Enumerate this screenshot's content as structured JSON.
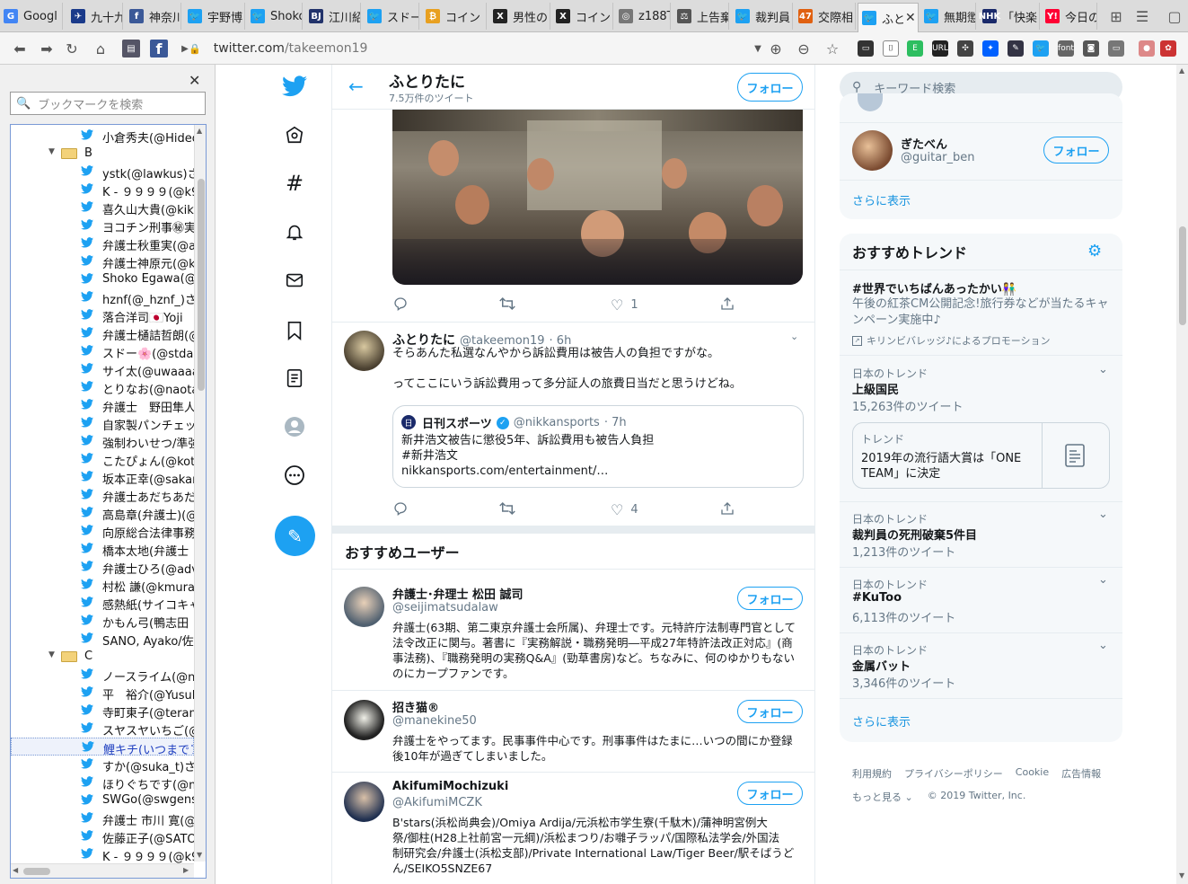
{
  "browser": {
    "tabs": [
      {
        "label": "Googl",
        "icon": "google-icon",
        "color": "#4285f4",
        "glyph": "G"
      },
      {
        "label": "九十九",
        "icon": "ship-icon",
        "color": "#1a3a8a",
        "glyph": "✈"
      },
      {
        "label": "神奈川",
        "icon": "facebook-icon",
        "color": "#3b5998",
        "glyph": "f"
      },
      {
        "label": "宇野博",
        "icon": "twitter-icon",
        "color": "#1da1f2",
        "glyph": "🐦"
      },
      {
        "label": "Shoko",
        "icon": "twitter-icon",
        "color": "#1da1f2",
        "glyph": "🐦"
      },
      {
        "label": "江川紹",
        "icon": "bj-icon",
        "color": "#22336b",
        "glyph": "BJ"
      },
      {
        "label": "スドー",
        "icon": "twitter-icon",
        "color": "#1da1f2",
        "glyph": "🐦"
      },
      {
        "label": "コイン",
        "icon": "coin-icon",
        "color": "#e8a020",
        "glyph": "₿"
      },
      {
        "label": "男性の",
        "icon": "x-icon",
        "color": "#222222",
        "glyph": "X"
      },
      {
        "label": "コイン",
        "icon": "x-icon",
        "color": "#222222",
        "glyph": "X"
      },
      {
        "label": "z188T",
        "icon": "globe-icon",
        "color": "#777777",
        "glyph": "◎"
      },
      {
        "label": "上告棄",
        "icon": "scale-icon",
        "color": "#555555",
        "glyph": "⚖"
      },
      {
        "label": "裁判員",
        "icon": "twitter-icon",
        "color": "#1da1f2",
        "glyph": "🐦"
      },
      {
        "label": "交際相",
        "icon": "news47-icon",
        "color": "#e06010",
        "glyph": "47"
      },
      {
        "label": "ふと",
        "icon": "twitter-icon",
        "color": "#1da1f2",
        "glyph": "🐦",
        "active": true
      },
      {
        "label": "無期懲",
        "icon": "twitter-icon",
        "color": "#1da1f2",
        "glyph": "🐦"
      },
      {
        "label": "「快楽",
        "icon": "nhk-icon",
        "color": "#1a2a6a",
        "glyph": "NHK"
      },
      {
        "label": "今日の",
        "icon": "yahoo-icon",
        "color": "#ff0033",
        "glyph": "Y!"
      }
    ],
    "url_host": "twitter.com",
    "url_path": "/takeemon19"
  },
  "bookmarks": {
    "search_placeholder": "ブックマークを検索",
    "items": [
      {
        "type": "link",
        "label": "小倉秀夫(@Hideo"
      },
      {
        "type": "folder",
        "label": "B"
      },
      {
        "type": "link",
        "label": "ystk(@lawkus)さん"
      },
      {
        "type": "link",
        "label": "K - ９９９９(@k99"
      },
      {
        "type": "link",
        "label": "喜久山大貴(@kik"
      },
      {
        "type": "link",
        "label": "ヨコチン刑事㊙実"
      },
      {
        "type": "link",
        "label": "弁護士秋重実(@a"
      },
      {
        "type": "link",
        "label": "弁護士神原元(@k"
      },
      {
        "type": "link",
        "label": "Shoko Egawa(@"
      },
      {
        "type": "link",
        "label": "hznf(@_hznf_)さん"
      },
      {
        "type": "link",
        "label": "落合洋司🇯🇵Yoji"
      },
      {
        "type": "link",
        "label": "弁護士樋詰哲朗(@"
      },
      {
        "type": "link",
        "label": "スドー🌸(@stdau"
      },
      {
        "type": "link",
        "label": "サイ太(@uwaaaa)"
      },
      {
        "type": "link",
        "label": "とりなお(@naotar"
      },
      {
        "type": "link",
        "label": "弁護士　野田隼人"
      },
      {
        "type": "link",
        "label": "自家製パンチェッタ"
      },
      {
        "type": "link",
        "label": "強制わいせつ/準強"
      },
      {
        "type": "link",
        "label": "こたぴょん(@kotac"
      },
      {
        "type": "link",
        "label": "坂本正幸(@sakan"
      },
      {
        "type": "link",
        "label": "弁護士あだちあだ"
      },
      {
        "type": "link",
        "label": "高島章(弁護士)(@"
      },
      {
        "type": "link",
        "label": "向原総合法律事務"
      },
      {
        "type": "link",
        "label": "橋本太地(弁護士"
      },
      {
        "type": "link",
        "label": "弁護士ひろ(@adv"
      },
      {
        "type": "link",
        "label": "村松 謙(@kmuran"
      },
      {
        "type": "link",
        "label": "感熱紙(サイコキャ"
      },
      {
        "type": "link",
        "label": "かもん弓(鴨志田"
      },
      {
        "type": "link",
        "label": "SANO, Ayako/佐"
      },
      {
        "type": "folder",
        "label": "C"
      },
      {
        "type": "link",
        "label": "ノースライム(@no"
      },
      {
        "type": "link",
        "label": "平　裕介(@Yusul"
      },
      {
        "type": "link",
        "label": "寺町東子(@teram"
      },
      {
        "type": "link",
        "label": "スヤスヤいちご(@"
      },
      {
        "type": "link",
        "label": "鯉キチ(いつまでフ",
        "selected": true
      },
      {
        "type": "link",
        "label": "すか(@suka_t)さん"
      },
      {
        "type": "link",
        "label": "ほりぐちです(@ms"
      },
      {
        "type": "link",
        "label": "SWGo(@swgensy"
      },
      {
        "type": "link",
        "label": "弁護士 市川 寛(@"
      },
      {
        "type": "link",
        "label": "佐藤正子(@SATO"
      },
      {
        "type": "link",
        "label": "K - ９９９９(@k99"
      }
    ]
  },
  "profile_header": {
    "name": "ふとりたに",
    "tweet_count": "7.5万件のツイート",
    "follow_label": "フォロー"
  },
  "tweet1": {
    "reply": "",
    "retweet": "",
    "likes": "1"
  },
  "tweet2": {
    "name": "ふとりたに",
    "handle": "@takeemon19",
    "time": "· 6h",
    "text_line1": "そらあんた私選なんやから訴訟費用は被告人の負担ですがな。",
    "text_line2": "ってここにいう訴訟費用って多分証人の旅費日当だと思うけどね。",
    "likes": "4",
    "quote": {
      "name": "日刊スポーツ",
      "handle": "@nikkansports",
      "time": "· 7h",
      "line1": "新井浩文被告に懲役5年、訴訟費用も被告人負担",
      "line2": "#新井浩文",
      "line3": "nikkansports.com/entertainment/…"
    }
  },
  "suggested": {
    "title": "おすすめユーザー",
    "users": [
      {
        "name": "弁護士･弁理士 松田 誠司",
        "handle": "@seijimatsudalaw",
        "follow": "フォロー",
        "bio": [
          "弁護士(63期、第二東京弁護士会所属)、弁理士です。元特許庁法制専門官として",
          "法令改正に関与。著書に『実務解説・職務発明―平成27年特許法改正対応』(商",
          "事法務)、『職務発明の実務Q&A』(勁草書房)など。ちなみに、何のゆかりもない",
          "のにカープファンです。"
        ]
      },
      {
        "name": "招き猫®",
        "handle": "@manekine50",
        "follow": "フォロー",
        "bio": [
          "弁護士をやってます。民事事件中心です。刑事事件はたまに…いつの間にか登録",
          "後10年が過ぎてしまいました。"
        ]
      },
      {
        "name": "AkifumiMochizuki",
        "handle": "@AkifumiMCZK",
        "follow": "フォロー",
        "bio": [
          "B'stars(浜松尚典会)/Omiya Ardija/元浜松市学生寮(千駄木)/蒲神明宮例大",
          "祭/御柱(H28上社前宮一元綱)/浜松まつり/お囃子ラッパ/国際私法学会/外国法",
          "制研究会/弁護士(浜松支部)/Private International Law/Tiger Beer/駅そばうど",
          "ん/SEIKO5SNZE67"
        ]
      }
    ]
  },
  "right": {
    "search_placeholder": "キーワード検索",
    "who_to_follow": {
      "name": "ぎたべん",
      "handle": "@guitar_ben",
      "follow": "フォロー",
      "more": "さらに表示"
    },
    "trends_title": "おすすめトレンド",
    "promo": {
      "name": "#世界でいちばんあったかい👫",
      "desc1": "午後の紅茶CM公開記念!旅行券などが当たるキャ",
      "desc2": "ンペーン実施中♪",
      "by": "キリンビバレッジ♪によるプロモーション"
    },
    "trends": [
      {
        "context": "日本のトレンド",
        "name": "上級国民",
        "count": "15,263件のツイート"
      },
      {
        "context": "日本のトレンド",
        "name": "裁判員の死刑破棄5件目",
        "count": "1,213件のツイート"
      },
      {
        "context": "日本のトレンド",
        "name": "#KuToo",
        "count": "6,113件のツイート"
      },
      {
        "context": "日本のトレンド",
        "name": "金属バット",
        "count": "3,346件のツイート"
      }
    ],
    "news": {
      "label": "トレンド",
      "line1": "2019年の流行語大賞は「ONE",
      "line2": "TEAM」に決定"
    },
    "trends_more": "さらに表示",
    "footer": [
      "利用規約",
      "プライバシーポリシー",
      "Cookie",
      "広告情報"
    ],
    "footer_more": "もっと見る",
    "copyright": "© 2019 Twitter, Inc."
  }
}
